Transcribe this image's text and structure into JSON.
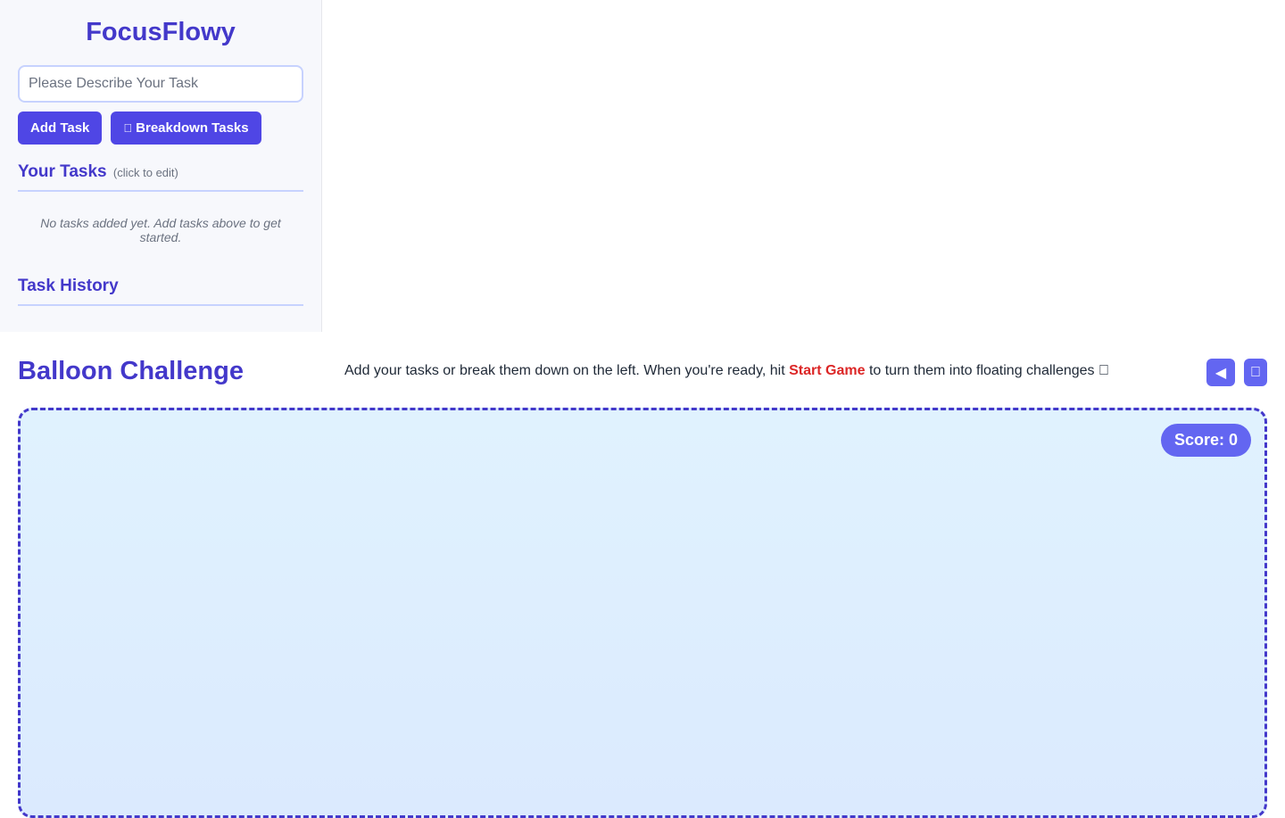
{
  "app": {
    "title": "FocusFlowy"
  },
  "sidebar": {
    "task_input": {
      "placeholder": "Please Describe Your Task",
      "value": ""
    },
    "add_task_label": "Add Task",
    "breakdown_icon": "",
    "breakdown_label": "Breakdown Tasks",
    "tasks_title": "Your Tasks",
    "tasks_hint": "(click to edit)",
    "empty_message": "No tasks added yet. Add tasks above to get started.",
    "history_title": "Task History"
  },
  "game": {
    "title": "Balloon Challenge",
    "instructions_before": "Add your tasks or break them down on the left. When you're ready, hit ",
    "instructions_highlight": "Start Game",
    "instructions_after": " to turn them into floating challenges ",
    "instructions_end_icon": "",
    "prev_button_icon": "◀",
    "next_button_icon": "",
    "score_label": "Score: 0"
  },
  "colors": {
    "accent": "#4f46e5",
    "title": "#4338ca",
    "highlight": "#dc2626",
    "game_bg": "#e0f2fe",
    "badge": "#6366f1"
  }
}
